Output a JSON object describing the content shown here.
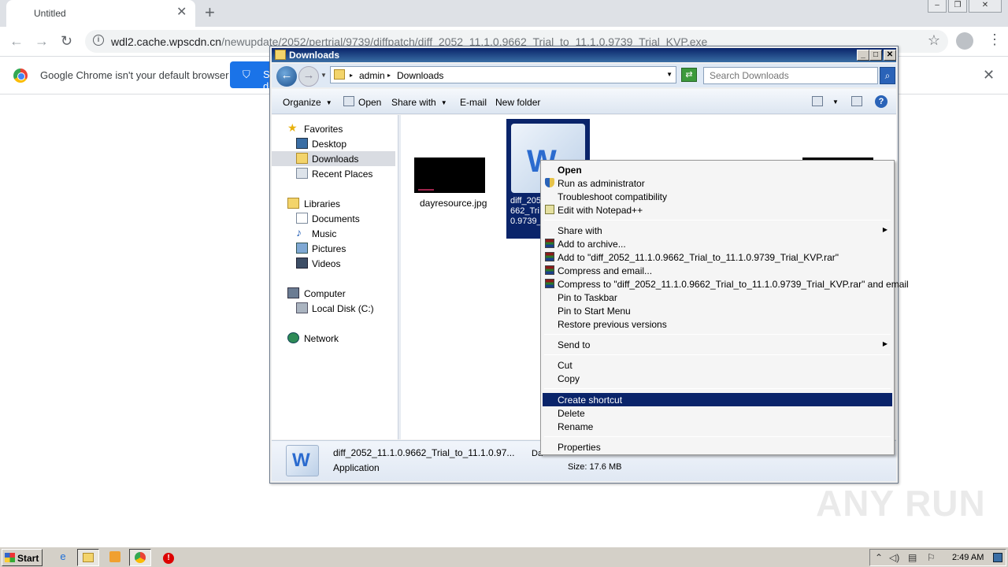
{
  "chrome": {
    "tab_title": "Untitled",
    "url_host": "wdl2.cache.wpscdn.cn",
    "url_path": "/newupdate/2052/pertrial/9739/diffpatch/diff_2052_11.1.0.9662_Trial_to_11.1.0.9739_Trial_KVP.exe",
    "infobar_text": "Google Chrome isn't your default browser",
    "infobar_button": "Set as default"
  },
  "explorer": {
    "title": "Downloads",
    "breadcrumb": [
      "admin",
      "Downloads"
    ],
    "search_placeholder": "Search Downloads",
    "toolbar": {
      "organize": "Organize",
      "open": "Open",
      "share_with": "Share with",
      "email": "E-mail",
      "new_folder": "New folder"
    },
    "nav": {
      "favorites": "Favorites",
      "desktop": "Desktop",
      "downloads": "Downloads",
      "recent_places": "Recent Places",
      "libraries": "Libraries",
      "documents": "Documents",
      "music": "Music",
      "pictures": "Pictures",
      "videos": "Videos",
      "computer": "Computer",
      "local_disk": "Local Disk (C:)",
      "network": "Network"
    },
    "files": {
      "jpg_name": "dayresource.jpg",
      "selected_name_partial": "diff_205\n662_Tri\n0.9739_"
    },
    "details": {
      "filename": "diff_2052_11.1.0.9662_Trial_to_11.1.0.97...",
      "date_fragment": "Da",
      "type": "Application",
      "size": "Size: 17.6 MB"
    }
  },
  "context_menu": {
    "open": "Open",
    "run_as_admin": "Run as administrator",
    "troubleshoot": "Troubleshoot compatibility",
    "edit_npp": "Edit with Notepad++",
    "share_with": "Share with",
    "add_archive": "Add to archive...",
    "add_to_rar": "Add to \"diff_2052_11.1.0.9662_Trial_to_11.1.0.9739_Trial_KVP.rar\"",
    "compress_email": "Compress and email...",
    "compress_rar_email": "Compress to \"diff_2052_11.1.0.9662_Trial_to_11.1.0.9739_Trial_KVP.rar\" and email",
    "pin_taskbar": "Pin to Taskbar",
    "pin_start": "Pin to Start Menu",
    "restore_versions": "Restore previous versions",
    "send_to": "Send to",
    "cut": "Cut",
    "copy": "Copy",
    "create_shortcut": "Create shortcut",
    "delete": "Delete",
    "rename": "Rename",
    "properties": "Properties"
  },
  "taskbar": {
    "start": "Start",
    "clock": "2:49 AM"
  },
  "watermark": "ANY RUN"
}
